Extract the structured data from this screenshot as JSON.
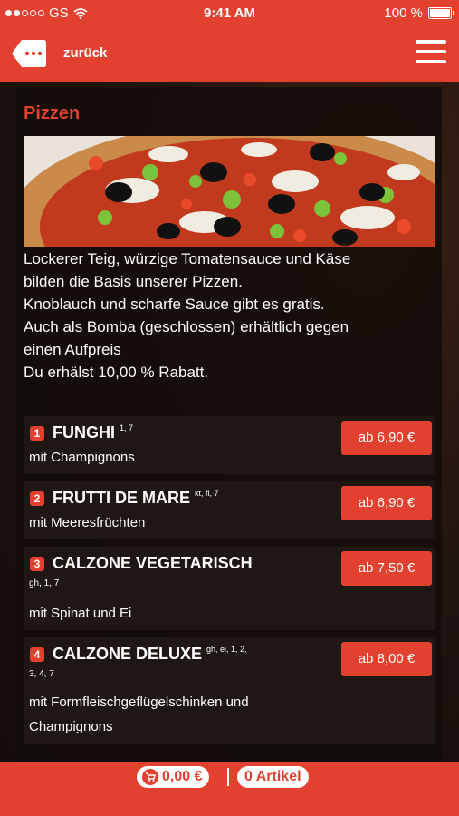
{
  "status": {
    "carrier": "GS",
    "time": "9:41 AM",
    "battery": "100 %"
  },
  "nav": {
    "back_label": "zurück"
  },
  "section": {
    "title": "Pizzen",
    "description": [
      "Lockerer Teig, würzige Tomatensauce und Käse",
      "bilden die Basis unserer Pizzen.",
      "Knoblauch und scharfe Sauce gibt es gratis.",
      "Auch als Bomba (geschlossen) erhältlich gegen",
      "einen Aufpreis",
      "Du erhälst 10,00 % Rabatt."
    ]
  },
  "items": [
    {
      "number": "1",
      "name": "FUNGHI",
      "allergens_inline": "1, 7",
      "allergens_line": "",
      "description": [
        "mit Champignons"
      ],
      "price": "ab 6,90 €"
    },
    {
      "number": "2",
      "name": "FRUTTI DE MARE",
      "allergens_inline": "kt, fi, 7",
      "allergens_line": "",
      "description": [
        "mit Meeresfrüchten"
      ],
      "price": "ab 6,90 €"
    },
    {
      "number": "3",
      "name": "CALZONE VEGETARISCH",
      "allergens_inline": "",
      "allergens_line": "gh, 1, 7",
      "description": [
        "mit Spinat und Ei"
      ],
      "price": "ab 7,50 €"
    },
    {
      "number": "4",
      "name": "CALZONE DELUXE",
      "allergens_inline": "gh, ei, 1, 2,",
      "allergens_line": "3, 4, 7",
      "description": [
        "mit Formfleischgeflügelschinken und",
        "Champignons"
      ],
      "price": "ab 8,00 €"
    }
  ],
  "footer": {
    "cart_total": "0,00 €",
    "article_count": "0 Artikel"
  },
  "colors": {
    "accent": "#e2412f",
    "background": "#1a1210"
  }
}
